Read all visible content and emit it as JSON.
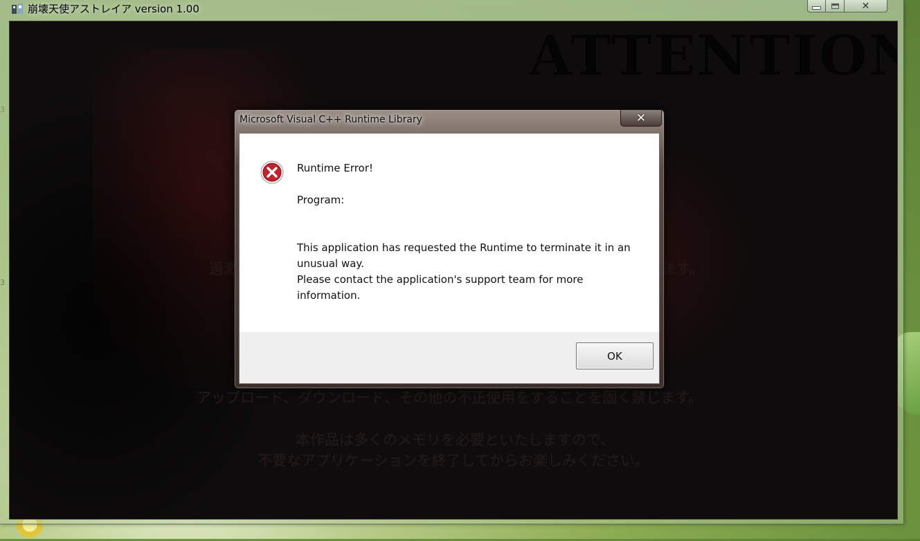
{
  "app_window": {
    "title": "崩壊天使アストレイア version 1.00",
    "buttons": {
      "close_glyph": "✕"
    }
  },
  "background": {
    "heading": "ATTENTION",
    "lines": [
      "アップロード、ダウンロード、その他の不正使用をすることを固く禁じます。",
      "本作品は多くのメモリを必要といたしますので、",
      "不要なアプリケーションを終了してからお楽しみください。"
    ],
    "fragment_left": "過激",
    "fragment_right": "ます。"
  },
  "dialog": {
    "title": "Microsoft Visual C++ Runtime Library",
    "close_glyph": "✕",
    "icon": "error-icon",
    "message": {
      "heading": "Runtime Error!",
      "program_label": "Program:",
      "line1": "This application has requested the Runtime to terminate it in an unusual way.",
      "line2": "Please contact the application's support team for more information."
    },
    "ok_label": "OK"
  },
  "colors": {
    "error_red": "#c8202a",
    "dialog_body": "#ffffff",
    "button_panel": "#f0f0f0"
  }
}
